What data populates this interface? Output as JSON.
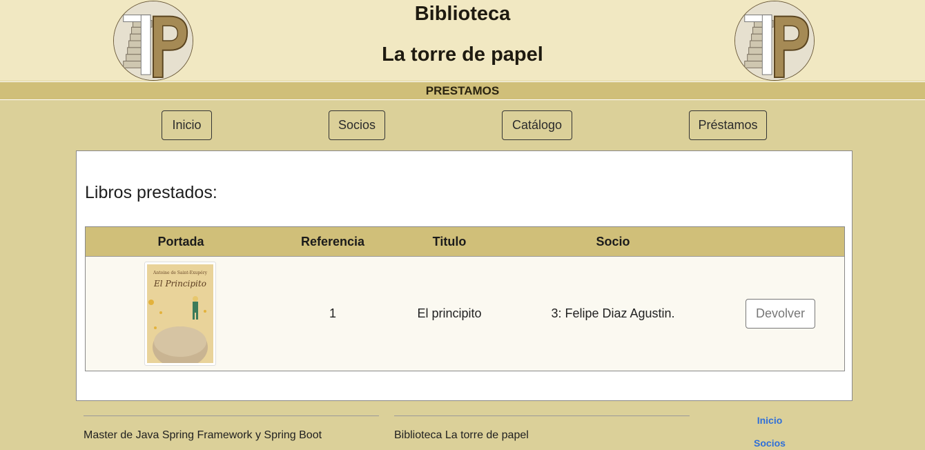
{
  "header": {
    "title_line1": "Biblioteca",
    "title_line2": "La torre de papel",
    "logo_left": "logo-icon",
    "logo_right": "logo-icon"
  },
  "section": {
    "label": "PRESTAMOS"
  },
  "nav": {
    "inicio": "Inicio",
    "socios": "Socios",
    "catalogo": "Catálogo",
    "prestamos": "Préstamos"
  },
  "main": {
    "heading": "Libros prestados:",
    "table": {
      "headers": {
        "portada": "Portada",
        "referencia": "Referencia",
        "titulo": "Titulo",
        "socio": "Socio"
      },
      "rows": [
        {
          "cover_author": "Antoine de Saint-Exupéry",
          "cover_title": "El Principito",
          "referencia": "1",
          "titulo": "El principito",
          "socio": "3: Felipe Diaz Agustin.",
          "action": "Devolver"
        }
      ]
    }
  },
  "footer": {
    "col1": "Master de Java Spring Framework y Spring Boot",
    "col2": "Biblioteca La torre de papel",
    "links": [
      "Inicio",
      "Socios"
    ]
  },
  "colors": {
    "background": "#dbd099",
    "header": "#f1e8c2",
    "accent": "#d0bf79",
    "link": "#2f6fd8"
  }
}
